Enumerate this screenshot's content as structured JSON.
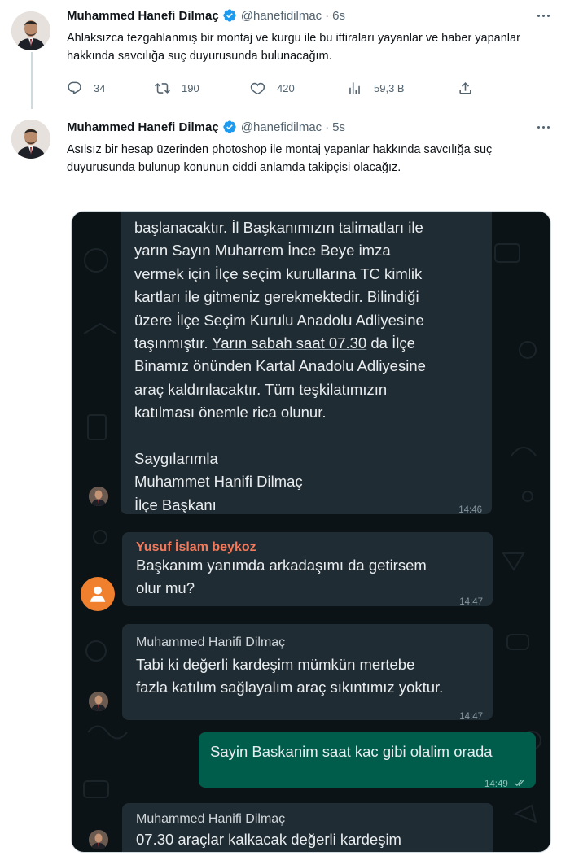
{
  "tweets": [
    {
      "author_name": "Muhammed Hanefi Dilmaç",
      "handle": "@hanefidilmac",
      "separator": "·",
      "time": "6s",
      "text": "Ahlaksızca tezgahlanmış bir montaj ve kurgu ile bu iftiraları yayanlar ve haber yapanlar hakkında savcılığa suç duyurusunda bulunacağım.",
      "stats": {
        "replies": "34",
        "retweets": "190",
        "likes": "420",
        "views": "59,3 B"
      }
    },
    {
      "author_name": "Muhammed Hanefi Dilmaç",
      "handle": "@hanefidilmac",
      "separator": "·",
      "time": "5s",
      "text": "Asılsız bir hesap üzerinden photoshop ile montaj yapanlar hakkında savcılığa suç duyurusunda bulunup konunun ciddi anlamda takipçisi olacağız."
    }
  ],
  "chat": {
    "message1": {
      "lines": [
        "başlanacaktır. İl Başkanımızın talimatları ile",
        "yarın Sayın Muharrem İnce Beye imza",
        "vermek için İlçe seçim kurullarına TC kimlik",
        "kartları ile gitmeniz gerekmektedir. Bilindiği",
        "üzere İlçe Seçim Kurulu Anadolu Adliyesine",
        "taşınmıştır. ",
        "Yarın sabah saat 07.30",
        " da İlçe",
        "Binamız önünden Kartal Anadolu Adliyesine",
        "araç kaldırılacaktır. Tüm teşkilatımızın",
        "katılması önemle rica olunur.",
        "Saygılarımla",
        "Muhammet Hanifi Dilmaç",
        "İlçe Başkanı"
      ],
      "time": "14:46"
    },
    "message2": {
      "sender": "Yusuf İslam beykoz",
      "lines": [
        "Başkanım yanımda arkadaşımı da getirsem",
        "olur mu?"
      ],
      "time": "14:47"
    },
    "message3": {
      "sender": "Muhammed Hanifi  Dilmaç",
      "lines": [
        "Tabi ki değerli kardeşim mümkün mertebe",
        "fazla katılım sağlayalım araç sıkıntımız yoktur."
      ],
      "time": "14:47"
    },
    "message4": {
      "text": "Sayin Baskanim saat kac gibi olalim orada",
      "time": "14:49"
    },
    "message5": {
      "sender": "Muhammed Hanifi  Dilmaç",
      "text": "07.30 araçlar kalkacak değerli kardeşim"
    }
  },
  "colors": {
    "verified": "#1d9bf0",
    "chat_bg": "#0c1317",
    "incoming_bubble": "#202c33",
    "outgoing_bubble": "#005c4b",
    "sender_orange": "#f4795b"
  },
  "icons": [
    "verified-badge-icon",
    "more-icon",
    "reply-icon",
    "retweet-icon",
    "like-icon",
    "views-icon",
    "share-icon",
    "read-receipt-icon",
    "user-icon"
  ]
}
